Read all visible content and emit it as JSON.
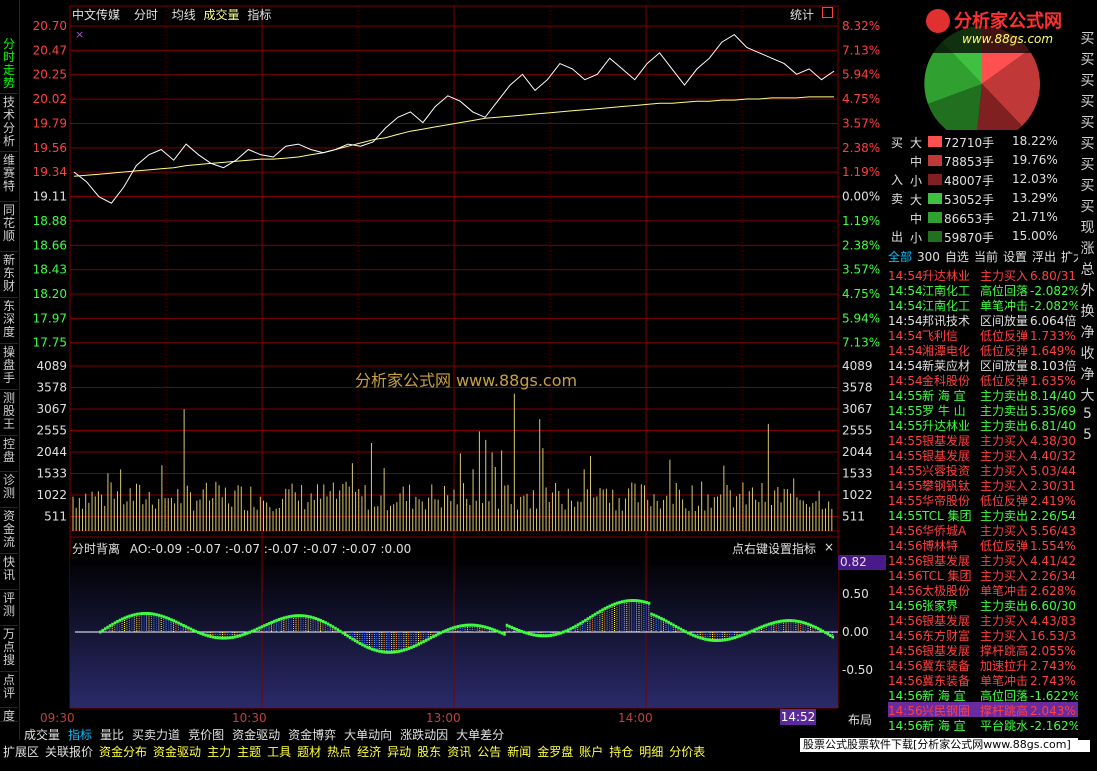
{
  "left_tabs": [
    {
      "label": "分时走势",
      "active": true
    },
    {
      "label": "技术分析",
      "active": false
    },
    {
      "label": "维赛特",
      "active": false
    },
    {
      "label": "同花顺",
      "active": false
    },
    {
      "label": "新东财",
      "active": false
    },
    {
      "label": "东深度",
      "active": false
    },
    {
      "label": "操盘手",
      "active": false
    },
    {
      "label": "测股王",
      "active": false
    },
    {
      "label": "控盘",
      "active": false
    },
    {
      "label": "诊测",
      "active": false
    },
    {
      "label": "资金流",
      "active": false
    },
    {
      "label": "快讯",
      "active": false
    },
    {
      "label": "评测",
      "active": false
    },
    {
      "label": "万点搜",
      "active": false
    },
    {
      "label": "点评",
      "active": false
    },
    {
      "label": "度",
      "active": false
    }
  ],
  "header": {
    "stock_name": "中文传媒",
    "mode": "分时",
    "avg_line": "均线",
    "volume": "成交量",
    "indicator": "指标",
    "stats": "统计",
    "marker": "×"
  },
  "price_axis": {
    "left": [
      "20.70",
      "20.47",
      "20.25",
      "20.02",
      "19.79",
      "19.56",
      "19.34",
      "19.11",
      "18.88",
      "18.66",
      "18.43",
      "18.20",
      "17.97",
      "17.75"
    ],
    "right": [
      "8.32%",
      "7.13%",
      "5.94%",
      "4.75%",
      "3.57%",
      "2.38%",
      "1.19%",
      "0.00%",
      "1.19%",
      "2.38%",
      "3.57%",
      "4.75%",
      "5.94%",
      "7.13%"
    ]
  },
  "volume_axis": [
    "4089",
    "3578",
    "3067",
    "2555",
    "2044",
    "1533",
    "1022",
    "511"
  ],
  "watermark": "分析家公式网 www.88gs.com",
  "indicator_header": {
    "name": "分时背离",
    "values": "AO:-0.09  :-0.07  :-0.07  :-0.07  :-0.07  :-0.07  :0.00",
    "right_hint": "点右键设置指标",
    "close": "×"
  },
  "indicator_axis": {
    "top_badge": "0.82",
    "ticks": [
      "0.50",
      "0.00",
      "-0.50"
    ]
  },
  "time_axis": {
    "labels": [
      "09:30",
      "10:30",
      "13:00",
      "14:00"
    ],
    "current": "14:52",
    "layout_btn": "布局"
  },
  "bottom_tabs_1": [
    "成交量",
    "指标",
    "量比",
    "买卖力道",
    "竞价图",
    "资金驱动",
    "资金博弈",
    "大单动向",
    "涨跌动因",
    "大单差分"
  ],
  "bottom_tabs_2": [
    "扩展区",
    "关联报价",
    "资金分布",
    "资金驱动",
    "主力",
    "主题",
    "工具",
    "题材",
    "热点",
    "经济",
    "异动",
    "股东",
    "资讯",
    "公告",
    "新闻",
    "金罗盘",
    "账户",
    "持仓",
    "明细",
    "分价表"
  ],
  "footer_banner": "股票公式股票软件下载[分析家公式网www.88gs.com]",
  "logo": {
    "title": "分析家公式网",
    "url": "www.88gs.com"
  },
  "flow": {
    "buy_label_top": "买",
    "buy_label_bottom": "入",
    "sell_label_top": "卖",
    "sell_label_bottom": "出",
    "buy": [
      {
        "size": "大",
        "vol": "72710手",
        "pct": "18.22%",
        "color": "#ff5050"
      },
      {
        "size": "中",
        "vol": "78853手",
        "pct": "19.76%",
        "color": "#c03838"
      },
      {
        "size": "小",
        "vol": "48007手",
        "pct": "12.03%",
        "color": "#802020"
      }
    ],
    "sell": [
      {
        "size": "大",
        "vol": "53052手",
        "pct": "13.29%",
        "color": "#40c040"
      },
      {
        "size": "中",
        "vol": "86653手",
        "pct": "21.71%",
        "color": "#30a030"
      },
      {
        "size": "小",
        "vol": "59870手",
        "pct": "15.00%",
        "color": "#207020"
      }
    ]
  },
  "news_tabs": [
    "全部",
    "300",
    "自选",
    "当前",
    "设置",
    "浮出",
    "扩大"
  ],
  "news": [
    {
      "t": "14:54",
      "name": "升达林业",
      "type": "主力买入",
      "val": "6.80/31",
      "c": "#ff4040"
    },
    {
      "t": "14:54",
      "name": "江南化工",
      "type": "高位回落",
      "val": "-2.082%",
      "c": "#40ff40"
    },
    {
      "t": "14:54",
      "name": "江南化工",
      "type": "单笔冲击",
      "val": "-2.082%",
      "c": "#40ff40"
    },
    {
      "t": "14:54",
      "name": "邦讯技术",
      "type": "区间放量",
      "val": "6.064倍",
      "c": "#e0e0e0"
    },
    {
      "t": "14:54",
      "name": "飞利信",
      "type": "低位反弹",
      "val": "1.733%",
      "c": "#ff4040"
    },
    {
      "t": "14:54",
      "name": "湘潭电化",
      "type": "低位反弹",
      "val": "1.649%",
      "c": "#ff4040"
    },
    {
      "t": "14:54",
      "name": "新莱应材",
      "type": "区间放量",
      "val": "8.103倍",
      "c": "#e0e0e0"
    },
    {
      "t": "14:54",
      "name": "金科股份",
      "type": "低位反弹",
      "val": "1.635%",
      "c": "#ff4040"
    },
    {
      "t": "14:55",
      "name": "新 海 宜",
      "type": "主力卖出",
      "val": "8.14/40",
      "c": "#40ff40"
    },
    {
      "t": "14:55",
      "name": "罗 牛 山",
      "type": "主力卖出",
      "val": "5.35/69",
      "c": "#40ff40"
    },
    {
      "t": "14:55",
      "name": "升达林业",
      "type": "主力卖出",
      "val": "6.81/40",
      "c": "#40ff40"
    },
    {
      "t": "14:55",
      "name": "银基发展",
      "type": "主力买入",
      "val": "4.38/30",
      "c": "#ff4040"
    },
    {
      "t": "14:55",
      "name": "银基发展",
      "type": "主力买入",
      "val": "4.40/32",
      "c": "#ff4040"
    },
    {
      "t": "14:55",
      "name": "兴蓉投资",
      "type": "主力买入",
      "val": "5.03/44",
      "c": "#ff4040"
    },
    {
      "t": "14:55",
      "name": "攀钢钒钛",
      "type": "主力买入",
      "val": "2.30/31",
      "c": "#ff4040"
    },
    {
      "t": "14:55",
      "name": "华帝股份",
      "type": "低位反弹",
      "val": "2.419%",
      "c": "#ff4040"
    },
    {
      "t": "14:55",
      "name": "TCL 集团",
      "type": "主力卖出",
      "val": "2.26/54",
      "c": "#40ff40"
    },
    {
      "t": "14:56",
      "name": "华侨城A",
      "type": "主力买入",
      "val": "5.56/43",
      "c": "#ff4040"
    },
    {
      "t": "14:56",
      "name": "博林特",
      "type": "低位反弹",
      "val": "1.554%",
      "c": "#ff4040"
    },
    {
      "t": "14:56",
      "name": "银基发展",
      "type": "主力买入",
      "val": "4.41/42",
      "c": "#ff4040"
    },
    {
      "t": "14:56",
      "name": "TCL 集团",
      "type": "主力买入",
      "val": "2.26/34",
      "c": "#ff4040"
    },
    {
      "t": "14:56",
      "name": "太极股份",
      "type": "单笔冲击",
      "val": "2.628%",
      "c": "#ff4040"
    },
    {
      "t": "14:56",
      "name": "张家界",
      "type": "主力卖出",
      "val": "6.60/30",
      "c": "#40ff40"
    },
    {
      "t": "14:56",
      "name": "银基发展",
      "type": "主力买入",
      "val": "4.43/83",
      "c": "#ff4040"
    },
    {
      "t": "14:56",
      "name": "东方财富",
      "type": "主力买入",
      "val": "16.53/3",
      "c": "#ff4040"
    },
    {
      "t": "14:56",
      "name": "银基发展",
      "type": "撑杆跳高",
      "val": "2.055%",
      "c": "#ff4040"
    },
    {
      "t": "14:56",
      "name": "冀东装备",
      "type": "加速拉升",
      "val": "2.743%",
      "c": "#ff4040"
    },
    {
      "t": "14:56",
      "name": "冀东装备",
      "type": "单笔冲击",
      "val": "2.743%",
      "c": "#ff4040"
    },
    {
      "t": "14:56",
      "name": "新 海 宜",
      "type": "高位回落",
      "val": "-1.622%",
      "c": "#40ff40"
    },
    {
      "t": "14:56",
      "name": "兴民钢圈",
      "type": "撑杆跳高",
      "val": "2.043%",
      "c": "#ff4040",
      "highlight": true
    },
    {
      "t": "14:56",
      "name": "新 海 宜",
      "type": "平台跳水",
      "val": "-2.162%",
      "c": "#40ff40"
    }
  ],
  "edge_chars": [
    "买",
    "买",
    "买",
    "买",
    "买",
    "买",
    "买",
    "买",
    "买",
    "现",
    "涨",
    "总",
    "外",
    "换",
    "净",
    "收",
    "净",
    "大",
    "5",
    "5"
  ],
  "colors": {
    "price_line": "#ffffff",
    "avg_line": "#ffff80",
    "grid": "#800000",
    "volume": "#d8c870",
    "up": "#ff4040",
    "down": "#40ff40"
  },
  "chart_data": {
    "type": "line",
    "price_range": [
      17.75,
      20.7
    ],
    "prev_close": 19.11,
    "price": [
      19.34,
      19.25,
      19.11,
      19.05,
      19.2,
      19.4,
      19.5,
      19.55,
      19.45,
      19.6,
      19.5,
      19.42,
      19.38,
      19.45,
      19.55,
      19.5,
      19.48,
      19.58,
      19.6,
      19.55,
      19.52,
      19.55,
      19.6,
      19.58,
      19.62,
      19.75,
      19.85,
      19.9,
      19.8,
      19.95,
      20.05,
      20.0,
      19.9,
      19.85,
      20.0,
      20.15,
      20.25,
      20.1,
      20.2,
      20.35,
      20.3,
      20.2,
      20.25,
      20.4,
      20.3,
      20.2,
      20.35,
      20.45,
      20.3,
      20.15,
      20.3,
      20.4,
      20.55,
      20.62,
      20.5,
      20.45,
      20.4,
      20.35,
      20.25,
      20.3,
      20.2,
      20.28
    ],
    "avg": [
      19.3,
      19.31,
      19.32,
      19.33,
      19.34,
      19.35,
      19.36,
      19.37,
      19.38,
      19.4,
      19.41,
      19.42,
      19.43,
      19.44,
      19.45,
      19.46,
      19.46,
      19.47,
      19.48,
      19.5,
      19.52,
      19.55,
      19.58,
      19.61,
      19.64,
      19.66,
      19.69,
      19.72,
      19.74,
      19.76,
      19.78,
      19.8,
      19.82,
      19.84,
      19.85,
      19.86,
      19.87,
      19.88,
      19.89,
      19.9,
      19.91,
      19.92,
      19.93,
      19.94,
      19.95,
      19.96,
      19.97,
      19.98,
      19.98,
      19.99,
      20.0,
      20.0,
      20.01,
      20.01,
      20.02,
      20.02,
      20.03,
      20.03,
      20.03,
      20.04,
      20.04,
      20.04
    ],
    "volume_max": 4089
  }
}
